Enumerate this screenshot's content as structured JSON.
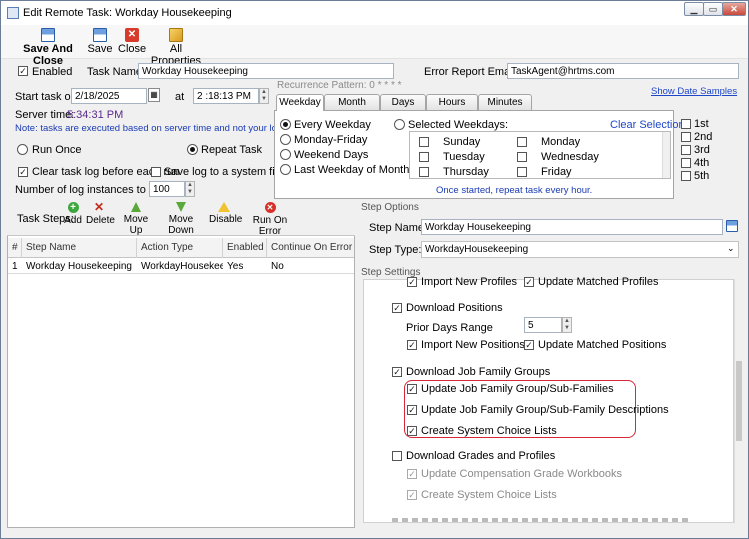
{
  "window": {
    "title": "Edit Remote Task: Workday Housekeeping",
    "controls": [
      "minimize",
      "maximize",
      "close"
    ]
  },
  "toolbar": {
    "save_and_close": "Save And Close",
    "save": "Save",
    "close": "Close",
    "all_properties": "All Properties"
  },
  "task": {
    "enabled_label": "Enabled",
    "enabled": true,
    "name_label": "Task Name:",
    "name_value": "Workday Housekeeping",
    "error_email_label": "Error Report Email:",
    "error_email_value": "TaskAgent@hrtms.com",
    "start_label": "Start task on",
    "start_date": "2/18/2025",
    "at_label": "at",
    "start_time": "2 :18:13 PM",
    "server_time_label": "Server time:",
    "server_time_value": "5:34:31 PM",
    "note": "Note: tasks are executed based on server time and not your local time!",
    "run_once_label": "Run Once",
    "repeat_task_label": "Repeat Task",
    "repeat_task": true,
    "clear_log_label": "Clear task log before each run",
    "clear_log": true,
    "save_log_label": "Save log to a system file",
    "save_log": false,
    "log_instances_label": "Number of log instances to keep:",
    "log_instances_value": "100"
  },
  "recurrence": {
    "header": "Recurrence Pattern: 0 * * * *",
    "show_samples": "Show Date Samples",
    "tabs": [
      "Weekday",
      "Month",
      "Days",
      "Hours",
      "Minutes"
    ],
    "active_tab": "Weekday",
    "options": [
      "Every Weekday",
      "Monday-Friday",
      "Weekend Days",
      "Last Weekday of Month"
    ],
    "selected_weekdays_label": "Selected Weekdays:",
    "clear_selection": "Clear Selection",
    "days_col1": [
      "Sunday",
      "Tuesday",
      "Thursday"
    ],
    "days_col2": [
      "Monday",
      "Wednesday",
      "Friday"
    ],
    "ordinals": [
      "1st",
      "2nd",
      "3rd",
      "4th",
      "5th"
    ],
    "footer": "Once started, repeat task every hour."
  },
  "steps": {
    "label": "Task Steps:",
    "buttons": [
      "Add",
      "Delete",
      "Move Up",
      "Move Down",
      "Disable",
      "Run On Error"
    ],
    "columns": [
      "#",
      "Step Name",
      "Action Type",
      "Enabled",
      "Continue On Error"
    ],
    "rows": [
      {
        "num": "1",
        "name": "Workday Housekeeping",
        "action": "WorkdayHousekeeping",
        "enabled": "Yes",
        "continue": "No"
      }
    ]
  },
  "step_options": {
    "header": "Step Options",
    "name_label": "Step Name:",
    "name_value": "Workday Housekeeping",
    "type_label": "Step Type:",
    "type_value": "WorkdayHousekeeping"
  },
  "step_settings": {
    "header": "Step Settings",
    "import_new_profiles": "Import New Profiles",
    "update_matched_profiles": "Update Matched Profiles",
    "download_positions": "Download Positions",
    "prior_days_range": "Prior Days Range",
    "prior_days_value": "5",
    "import_new_positions": "Import New Positions",
    "update_matched_positions": "Update Matched Positions",
    "download_job_family_groups": "Download Job Family Groups",
    "update_jfg": "Update Job Family Group/Sub-Families",
    "update_jfg_desc": "Update Job Family Group/Sub-Family Descriptions",
    "create_choice_lists": "Create System Choice Lists",
    "download_grades": "Download Grades and Profiles",
    "update_comp_grade": "Update Compensation Grade Workbooks",
    "create_choice_lists_2": "Create System Choice Lists"
  }
}
